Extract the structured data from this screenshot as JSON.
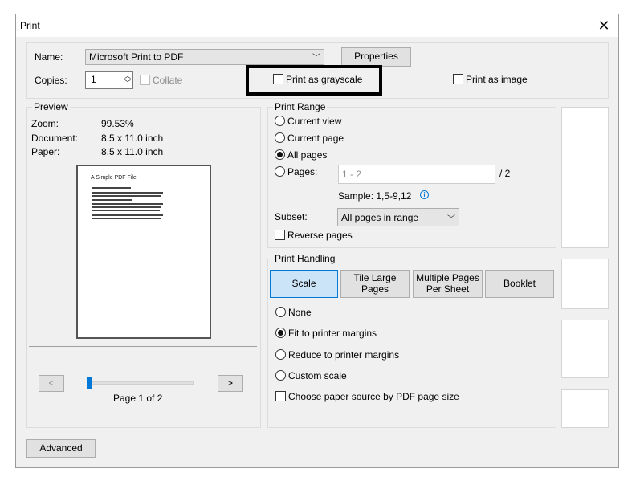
{
  "window": {
    "title": "Print",
    "close_icon": "close-icon"
  },
  "printer": {
    "name_label": "Name:",
    "name_value": "Microsoft Print to PDF",
    "properties_label": "Properties",
    "copies_label": "Copies:",
    "copies_value": "1",
    "collate_label": "Collate",
    "collate_checked": false,
    "grayscale_label": "Print as grayscale",
    "grayscale_checked": false,
    "image_label": "Print as image",
    "image_checked": false
  },
  "preview": {
    "group_label": "Preview",
    "zoom_label": "Zoom:",
    "zoom_value": "99.53%",
    "document_label": "Document:",
    "document_value": "8.5 x 11.0 inch",
    "paper_label": "Paper:",
    "paper_value": "8.5 x 11.0 inch",
    "page_title": "A Simple PDF File",
    "prev_label": "<",
    "next_label": ">",
    "page_indicator": "Page 1 of 2",
    "slider_position": "page 1 of 2"
  },
  "print_range": {
    "group_label": "Print Range",
    "options": [
      {
        "label": "Current view",
        "selected": false
      },
      {
        "label": "Current page",
        "selected": false
      },
      {
        "label": "All pages",
        "selected": true
      },
      {
        "label": "Pages:",
        "selected": false
      }
    ],
    "pages_placeholder": "1 - 2",
    "pages_total": "/ 2",
    "sample_text": "Sample: 1,5-9,12",
    "subset_label": "Subset:",
    "subset_value": "All pages in range",
    "reverse_label": "Reverse pages",
    "reverse_checked": false
  },
  "print_handling": {
    "group_label": "Print Handling",
    "tabs": [
      {
        "label": "Scale",
        "active": true
      },
      {
        "label": "Tile Large Pages",
        "active": false
      },
      {
        "label": "Multiple Pages Per Sheet",
        "active": false
      },
      {
        "label": "Booklet",
        "active": false
      }
    ],
    "scale_options": [
      {
        "label": "None",
        "selected": false
      },
      {
        "label": "Fit to printer margins",
        "selected": true
      },
      {
        "label": "Reduce to printer margins",
        "selected": false
      },
      {
        "label": "Custom scale",
        "selected": false
      }
    ],
    "paper_source_label": "Choose paper source by PDF page size",
    "paper_source_checked": false
  },
  "footer": {
    "advanced_label": "Advanced"
  }
}
